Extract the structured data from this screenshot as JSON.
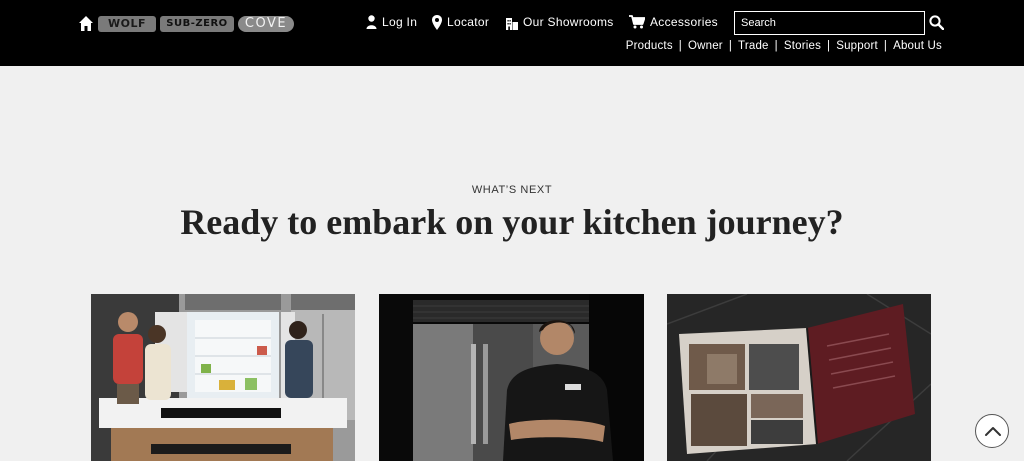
{
  "header": {
    "brands": [
      "WOLF",
      "SUB-ZERO",
      "COVE"
    ],
    "utility_links": {
      "login": "Log In",
      "locator": "Locator",
      "showrooms": "Our Showrooms",
      "accessories": "Accessories"
    },
    "search": {
      "placeholder": "Search"
    },
    "main_nav": [
      "Products",
      "Owner",
      "Trade",
      "Stories",
      "Support",
      "About Us"
    ],
    "nav_separator": "|"
  },
  "hero": {
    "eyebrow": "WHAT’S NEXT",
    "headline": "Ready to embark on your kitchen journey?"
  },
  "colors": {
    "header_bg": "#000000",
    "page_bg": "#f0f0f0",
    "text": "#222222"
  },
  "icons": [
    "home-icon",
    "user-icon",
    "location-pin-icon",
    "building-icon",
    "cart-icon",
    "search-icon",
    "chevron-up-icon"
  ]
}
